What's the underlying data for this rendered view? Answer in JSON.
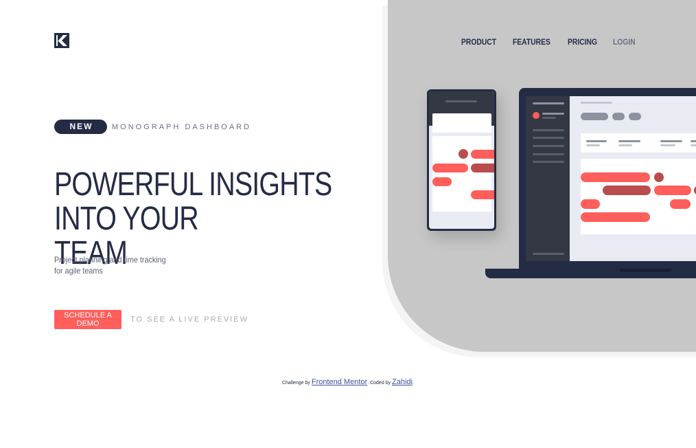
{
  "brand": {
    "logo": "monograph-logo-icon"
  },
  "nav": {
    "links": [
      "PRODUCT",
      "FEATURES",
      "PRICING"
    ],
    "login": "LOGIN"
  },
  "hero": {
    "badge": "NEW",
    "tagline": "MONOGRAPH DASHBOARD",
    "headline_line1": "POWERFUL INSIGHTS INTO YOUR",
    "headline_line2": "TEAM",
    "sub_line1": "Project planning and time tracking",
    "sub_line2": "for agile teams",
    "cta_button": "SCHEDULE A DEMO",
    "cta_link": "TO SEE A LIVE PREVIEW"
  },
  "attribution": {
    "prefix": "Challenge by",
    "challenge_link": "Frontend Mentor",
    "middle": ". Coded by",
    "author_link": "Zahidi",
    "suffix": "."
  },
  "colors": {
    "navy": "#242b45",
    "coral": "#ff5e5b",
    "dark_red": "#b94c4c",
    "panel_gray": "#c7c7c7",
    "muted": "#6b7183"
  }
}
